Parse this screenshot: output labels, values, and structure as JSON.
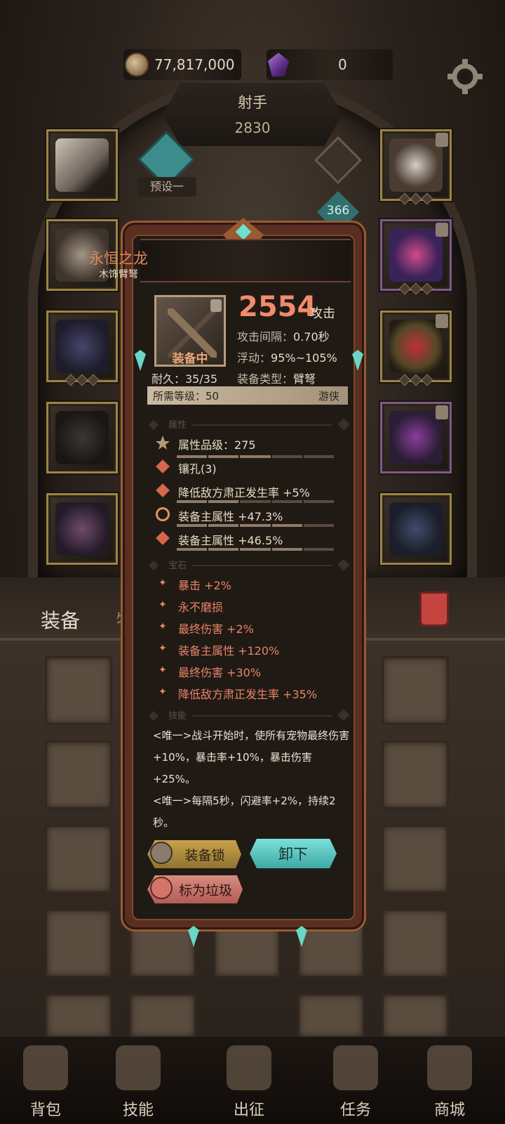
{
  "currency": {
    "gold": "77,817,000",
    "gems": "0"
  },
  "hero": {
    "class_name": "射手",
    "power": "2830",
    "preset_label": "预设一",
    "level": "366"
  },
  "item": {
    "name": "永恒之龙",
    "type": "木饰臂弩",
    "equipped_label": "装备中",
    "durability": "耐久：35/35",
    "attack_value": "2554",
    "attack_label": "攻击",
    "attack_interval_label": "攻击间隔：",
    "attack_interval": "0.70秒",
    "float_label": "浮动：",
    "float_value": "95%~105%",
    "equip_type_label": "装备类型：",
    "equip_type": "臂弩",
    "required_level": "所需等级：50",
    "class_restriction": "游侠"
  },
  "sections": {
    "attributes": "属性",
    "gems": "宝石",
    "skills": "技能"
  },
  "attributes": [
    {
      "text": "属性品级：275",
      "icon": "gold"
    },
    {
      "text": "镶孔(3)",
      "icon": "red"
    },
    {
      "text": "降低敌方肃正发生率 +5%",
      "icon": "red"
    },
    {
      "text": "装备主属性 +47.3%",
      "icon": "orange"
    },
    {
      "text": "装备主属性 +46.5%",
      "icon": "red"
    }
  ],
  "gem_stats": [
    "暴击 +2%",
    "永不磨损",
    "最终伤害 +2%",
    "装备主属性 +120%",
    "最终伤害 +30%",
    "降低敌方肃正发生率 +35%"
  ],
  "skills": [
    "<唯一>战斗开始时，使所有宠物最终伤害+10%，暴击率+10%，暴击伤害+25%。",
    "<唯一>每隔5秒，闪避率+2%，持续2秒。"
  ],
  "buttons": {
    "lock": "装备锁",
    "unequip": "卸下",
    "junk": "标为垃圾"
  },
  "inventory_tabs": {
    "equipment": "装备",
    "items": "物"
  },
  "nav": [
    {
      "label": "背包",
      "icon": "backpack-icon"
    },
    {
      "label": "技能",
      "icon": "skill-book-icon"
    },
    {
      "label": "出征",
      "icon": "expedition-map-icon"
    },
    {
      "label": "任务",
      "icon": "quest-horn-icon"
    },
    {
      "label": "商城",
      "icon": "shop-crown-icon"
    }
  ],
  "colors": {
    "accent_red": "#f08b6c",
    "gem_text": "#e8846a",
    "teal": "#69d6c6",
    "frame_gold": "#9b8445"
  }
}
